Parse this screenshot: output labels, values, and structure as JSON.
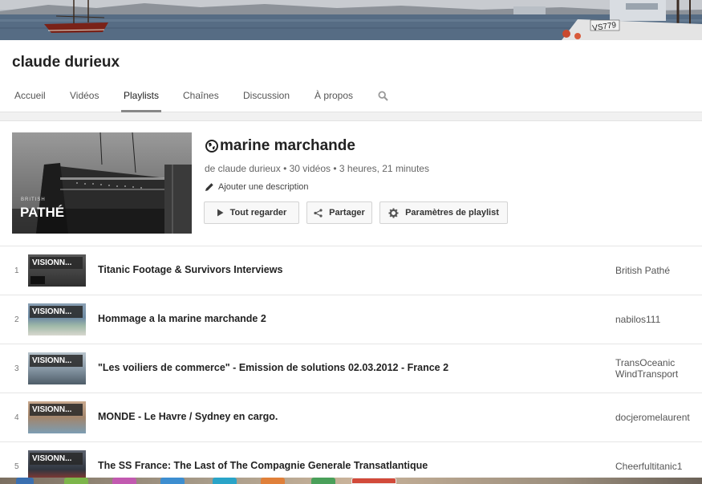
{
  "channel": {
    "name": "claude durieux"
  },
  "tabs": [
    {
      "label": "Accueil"
    },
    {
      "label": "Vidéos"
    },
    {
      "label": "Playlists"
    },
    {
      "label": "Chaînes"
    },
    {
      "label": "Discussion"
    },
    {
      "label": "À propos"
    }
  ],
  "active_tab": "Playlists",
  "playlist": {
    "title": "marine marchande",
    "meta_owner": "de claude durieux",
    "meta_count": "30 vidéos",
    "meta_duration": "3 heures, 21 minutes",
    "add_description": "Ajouter une description",
    "thumb_brand_small": "BRITISH",
    "thumb_brand_big": "PATHÉ",
    "buttons": {
      "watch_all": "Tout regarder",
      "share": "Partager",
      "settings": "Paramètres de playlist"
    }
  },
  "thumb_overlay": "VISIONN...",
  "videos": [
    {
      "index": "1",
      "title": "Titanic Footage & Survivors Interviews",
      "owner": "British Pathé"
    },
    {
      "index": "2",
      "title": "Hommage a la marine marchande 2",
      "owner": "nabilos111"
    },
    {
      "index": "3",
      "title": "\"Les voiliers de commerce\" - Emission de solutions 02.03.2012 - France 2",
      "owner": "TransOceanic WindTransport"
    },
    {
      "index": "4",
      "title": "MONDE - Le Havre / Sydney en cargo.",
      "owner": "docjeromelaurent"
    },
    {
      "index": "5",
      "title": "The SS France: The Last of The Compagnie Generale Transatlantique",
      "owner": "Cheerfultitanic1"
    }
  ],
  "colors": {
    "page_bg": "#f1f1f1",
    "card_bg": "#ffffff",
    "active_tab_underline": "#888888",
    "text_primary": "#222222",
    "text_secondary": "#666666"
  },
  "icons": {
    "search": "search-icon",
    "globe": "globe-icon",
    "pencil": "pencil-icon",
    "play": "play-icon",
    "share": "share-icon",
    "gear": "gear-icon"
  }
}
